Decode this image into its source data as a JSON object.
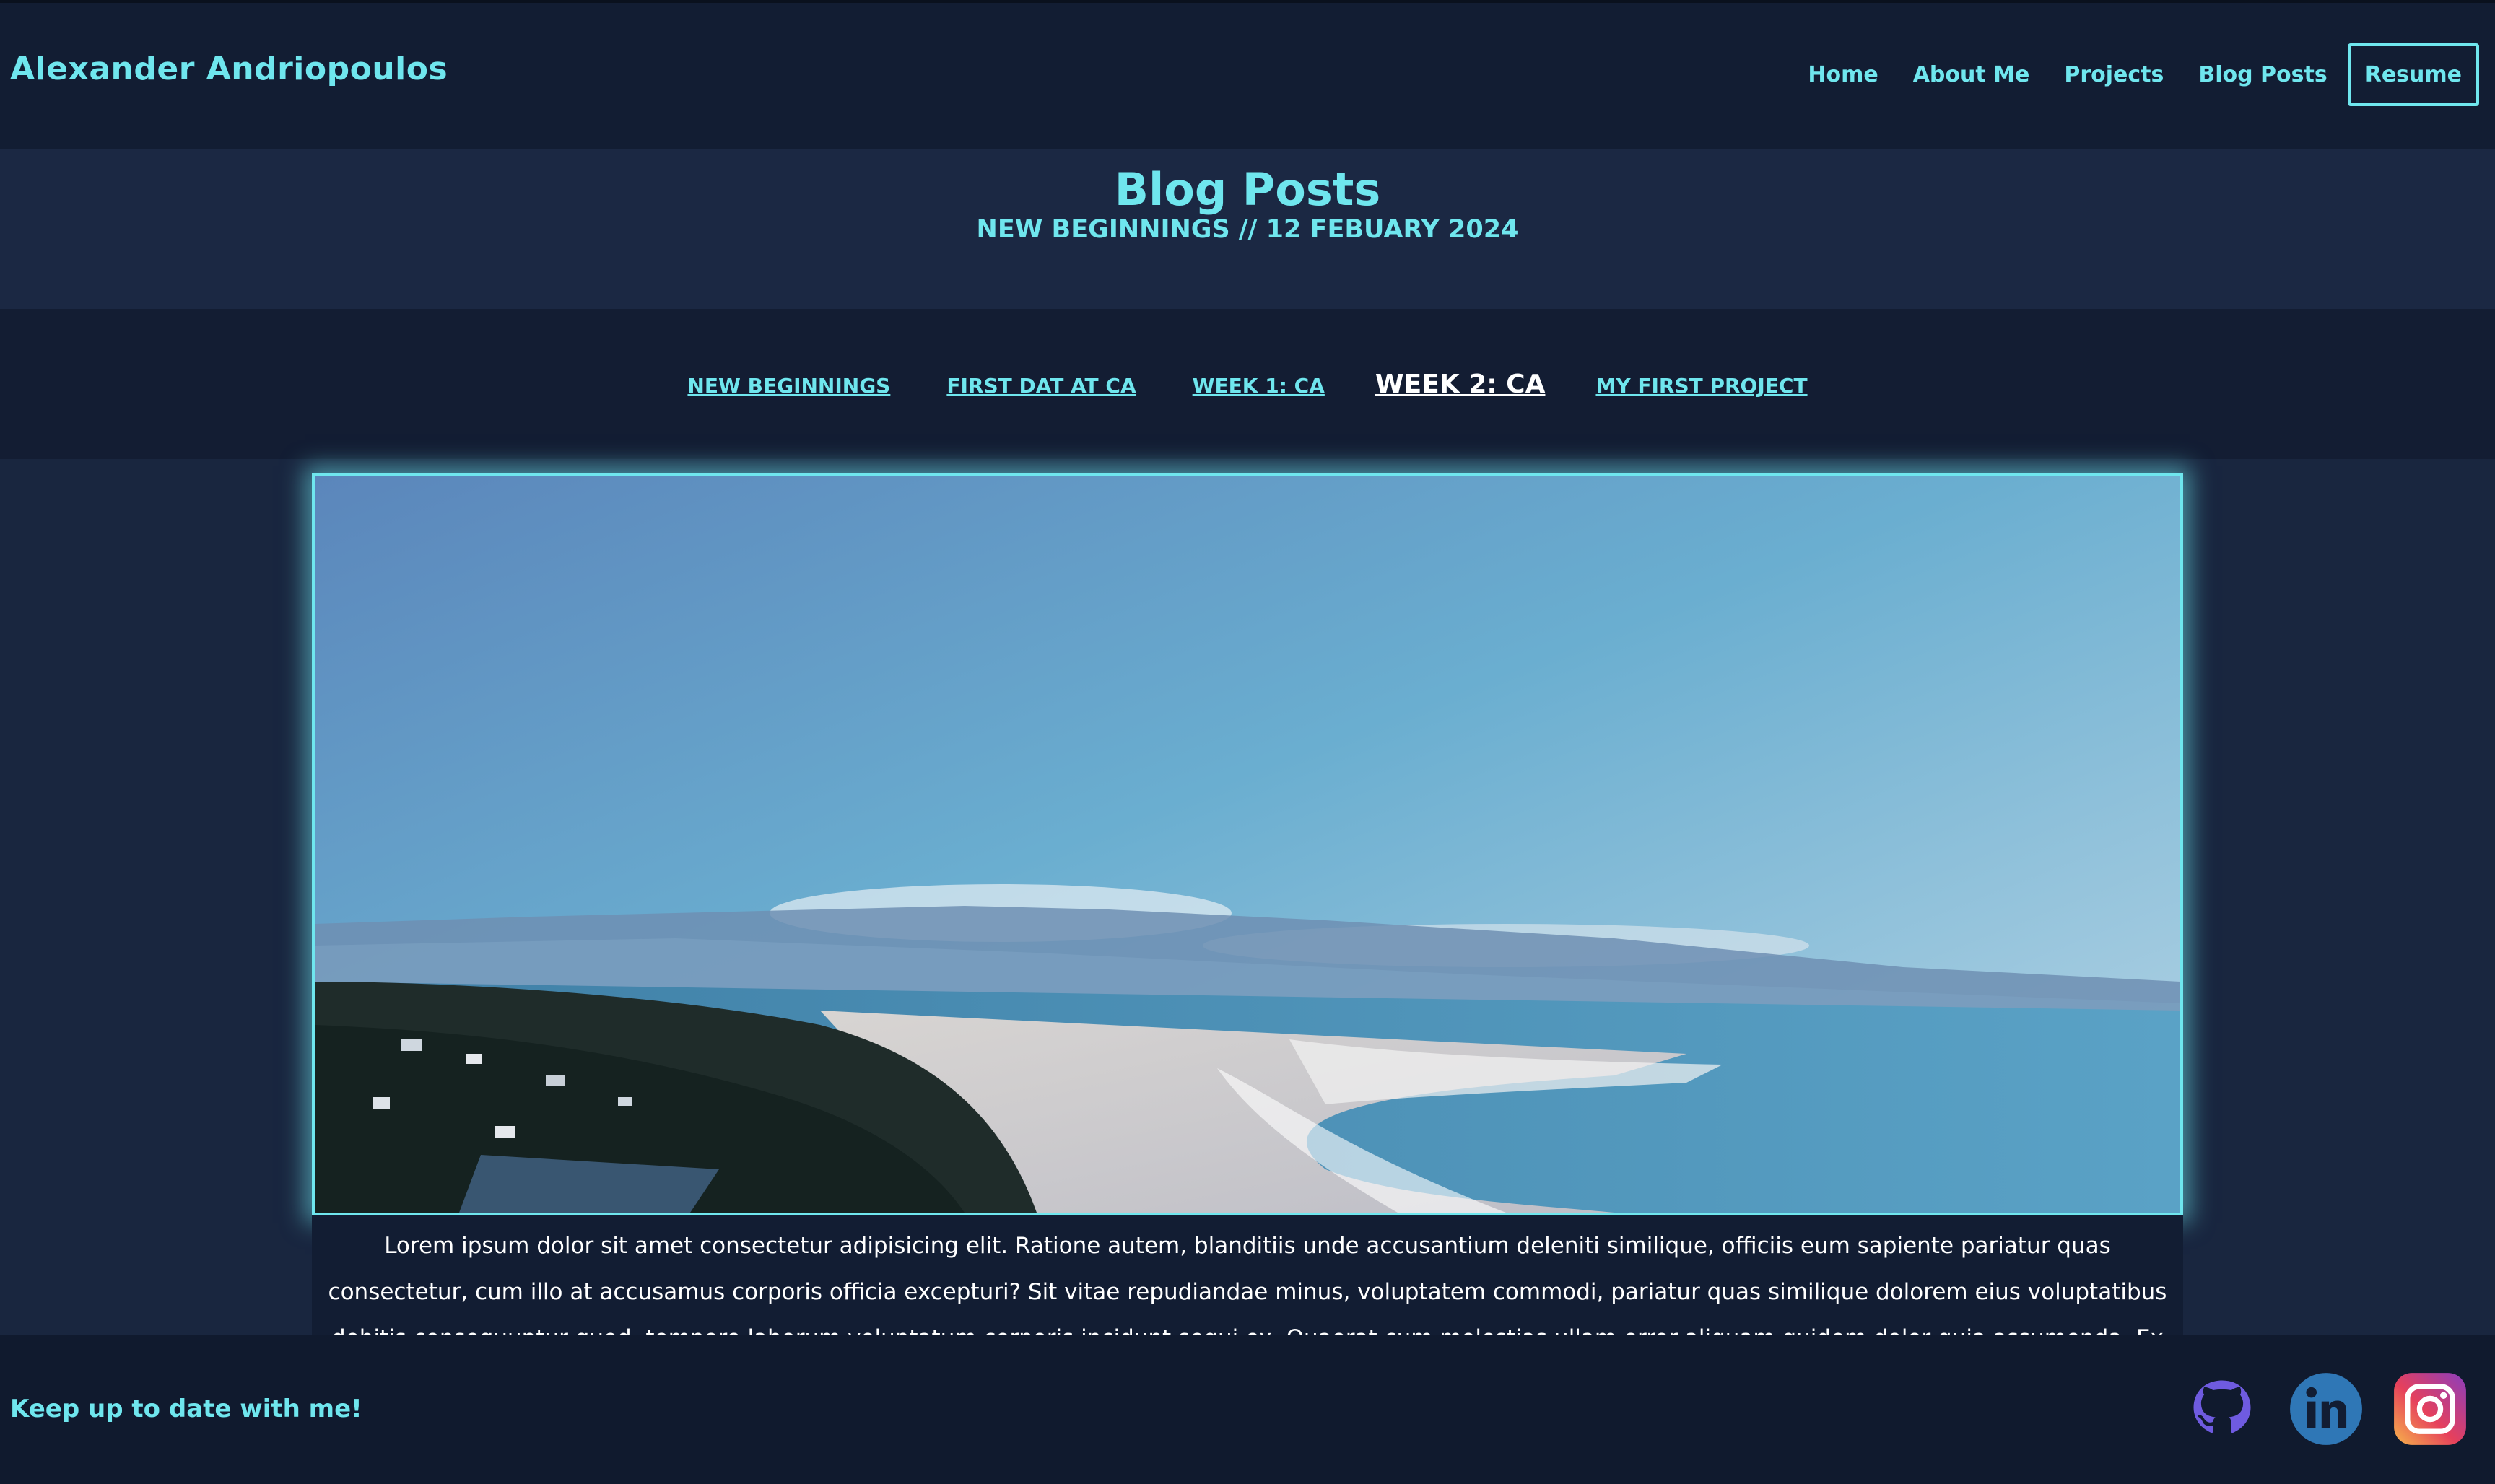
{
  "header": {
    "brand": "Alexander Andriopoulos",
    "nav": [
      {
        "label": "Home"
      },
      {
        "label": "About Me"
      },
      {
        "label": "Projects"
      },
      {
        "label": "Blog Posts"
      }
    ],
    "resume_label": "Resume"
  },
  "title_band": {
    "title": "Blog Posts",
    "subtitle": "NEW BEGINNINGS // 12 FEBUARY 2024"
  },
  "post_nav": [
    {
      "label": "NEW BEGINNINGS",
      "active": false
    },
    {
      "label": "FIRST DAT AT CA",
      "active": false
    },
    {
      "label": "WEEK 1: CA",
      "active": false
    },
    {
      "label": "WEEK 2: CA",
      "active": true
    },
    {
      "label": "MY FIRST PROJECT",
      "active": false
    }
  ],
  "hero_image": {
    "icon": "coastal-landscape-photo"
  },
  "content": {
    "paragraph": "Lorem ipsum dolor sit amet consectetur adipisicing elit. Ratione autem, blanditiis unde accusantium deleniti similique, officiis eum sapiente pariatur quas consectetur, cum illo at accusamus corporis officia excepturi? Sit vitae repudiandae minus, voluptatem commodi, pariatur quas similique dolorem eius voluptatibus debitis consequuntur quod, tempore laborum voluptatum corporis incidunt sequi ex. Quaerat cum molestias ullam error aliquam quidem dolor quia assumenda. Ex consectetur incidunt modi quam dignissimos ipsa."
  },
  "footer": {
    "text": "Keep up to date with me!",
    "social": [
      {
        "icon": "github-icon"
      },
      {
        "icon": "linkedin-icon"
      },
      {
        "icon": "instagram-icon"
      }
    ]
  },
  "colors": {
    "accent": "#6fe6ee",
    "header_bg": "#121d33",
    "page_bg": "#19263f",
    "active_link": "#ffffff"
  }
}
